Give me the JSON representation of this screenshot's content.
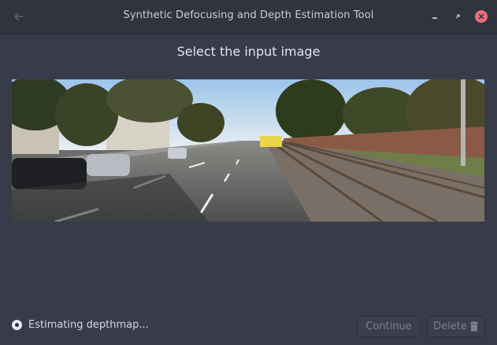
{
  "window": {
    "title": "Synthetic Defocusing and Depth Estimation Tool",
    "controls": [
      "back-icon",
      "minimize-icon",
      "maximize-icon",
      "close-icon"
    ]
  },
  "main": {
    "heading": "Select the input image",
    "image_description_icon": "photo"
  },
  "footer": {
    "status_text": "Estimating depthmap...",
    "continue_label": "Continue",
    "delete_label": "Delete"
  },
  "colors": {
    "window_bg": "#383c4a",
    "titlebar_bg": "#2f343f",
    "close_button": "#e56f7b",
    "disabled_text": "#7c818c"
  }
}
